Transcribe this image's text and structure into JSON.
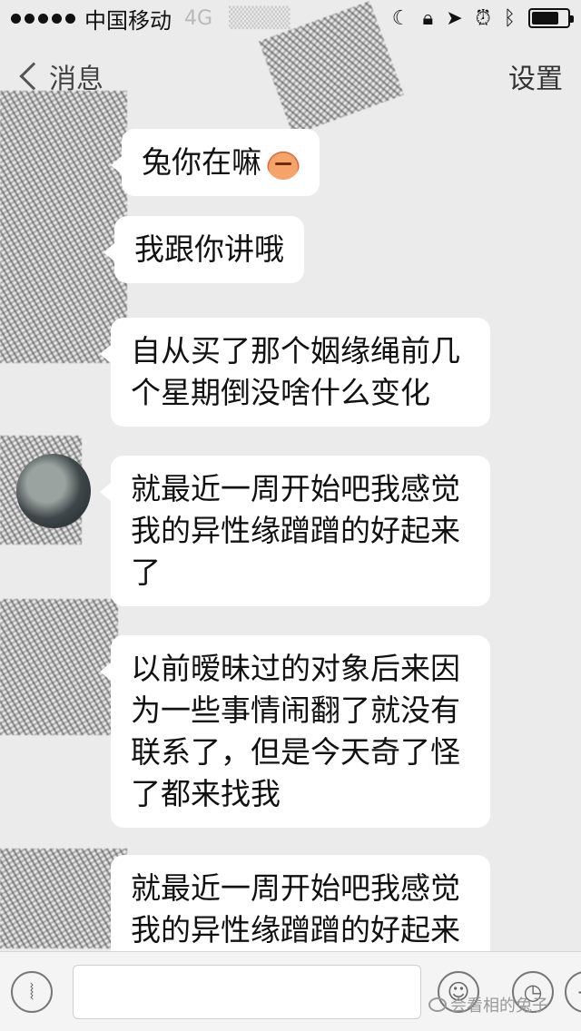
{
  "status_bar": {
    "carrier": "中国移动",
    "network": "4G",
    "battery_level": 0.75
  },
  "nav": {
    "back_label": "消息",
    "settings_label": "设置"
  },
  "messages": [
    {
      "text": "兔你在嘛"
    },
    {
      "text": "我跟你讲哦"
    },
    {
      "text": "自从买了那个姻缘绳前几个星期倒没啥什么变化"
    },
    {
      "text": "就最近一周开始吧我感觉我的异性缘蹭蹭的好起来了"
    },
    {
      "text": "以前暧昧过的对象后来因为一些事情闹翻了就没有联系了，但是今天奇了怪了都来找我"
    },
    {
      "text": "就最近一周开始吧我感觉我的异性缘蹭蹭的好起来"
    }
  ],
  "input_bar": {
    "watermark": "会看相的兔子"
  }
}
